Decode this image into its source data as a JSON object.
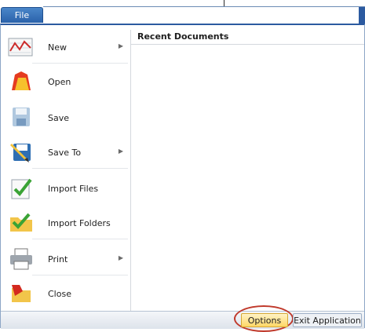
{
  "file_tab": "File",
  "menu": [
    {
      "label": "New",
      "icon": "new-chart-icon",
      "arrow": true,
      "disabled": false,
      "bold": false
    },
    {
      "label": "Open",
      "icon": "open-icon",
      "arrow": false,
      "disabled": false,
      "bold": false
    },
    {
      "label": "Save",
      "icon": "save-icon",
      "arrow": false,
      "disabled": true,
      "bold": false
    },
    {
      "label": "Save To",
      "icon": "save-to-icon",
      "arrow": true,
      "disabled": false,
      "bold": false
    },
    {
      "label": "Import Files",
      "icon": "import-files-icon",
      "arrow": false,
      "disabled": false,
      "bold": true
    },
    {
      "label": "Import Folders",
      "icon": "import-folders-icon",
      "arrow": false,
      "disabled": false,
      "bold": true
    },
    {
      "label": "Print",
      "icon": "printer-icon",
      "arrow": true,
      "disabled": false,
      "bold": false
    },
    {
      "label": "Close",
      "icon": "close-icon",
      "arrow": false,
      "disabled": false,
      "bold": false
    }
  ],
  "recent_documents_title": "Recent Documents",
  "footer": {
    "options_label": "Options",
    "exit_label": "Exit Application"
  },
  "colors": {
    "accent": "#2c5aa0",
    "highlight_ring": "#c0392b",
    "options_bg": "#ffd766"
  }
}
